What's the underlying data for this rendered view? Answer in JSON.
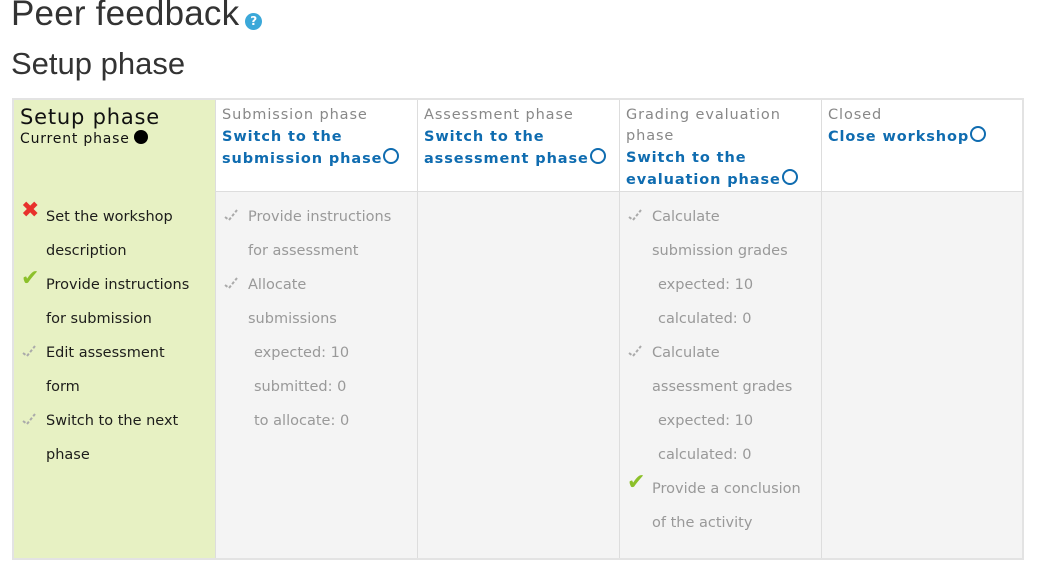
{
  "page": {
    "title": "Peer feedback",
    "help_icon": "question-circle-icon",
    "subtitle": "Setup phase"
  },
  "phases": [
    {
      "name": "Setup phase",
      "current_label": "Current phase",
      "active": true,
      "tasks": [
        {
          "label": "Set the workshop description",
          "status": "fail",
          "icon": "cross-icon",
          "details": []
        },
        {
          "label": "Provide instructions for submission",
          "status": "done",
          "icon": "check-icon",
          "details": []
        },
        {
          "label": "Edit assessment form",
          "status": "todo",
          "icon": "todo-check-icon",
          "details": []
        },
        {
          "label": "Switch to the next phase",
          "status": "todo",
          "icon": "todo-check-icon",
          "details": []
        }
      ]
    },
    {
      "name": "Submission phase",
      "switch_label": "Switch to the submission phase",
      "active": false,
      "tasks": [
        {
          "label": "Provide instructions for assessment",
          "status": "todo",
          "icon": "todo-check-icon",
          "details": []
        },
        {
          "label": "Allocate submissions",
          "status": "todo",
          "icon": "todo-check-icon",
          "details": [
            "expected: 10",
            "submitted: 0",
            "to allocate: 0"
          ]
        }
      ]
    },
    {
      "name": "Assessment phase",
      "switch_label": "Switch to the assessment phase",
      "active": false,
      "tasks": []
    },
    {
      "name": "Grading evaluation phase",
      "switch_label": "Switch to the evaluation phase",
      "active": false,
      "tasks": [
        {
          "label": "Calculate submission grades",
          "status": "todo",
          "icon": "todo-check-icon",
          "details": [
            "expected: 10",
            "calculated: 0"
          ]
        },
        {
          "label": "Calculate assessment grades",
          "status": "todo",
          "icon": "todo-check-icon",
          "details": [
            "expected: 10",
            "calculated: 0"
          ]
        },
        {
          "label": "Provide a conclusion of the activity",
          "status": "done",
          "icon": "check-icon",
          "details": []
        }
      ]
    },
    {
      "name": "Closed",
      "switch_label": "Close workshop",
      "active": false,
      "tasks": []
    }
  ],
  "colors": {
    "active_phase_bg": "#e7f1c3",
    "link": "#0f6cb0",
    "done": "#8cc02a",
    "fail": "#e8312c",
    "help": "#3ba8d9"
  }
}
